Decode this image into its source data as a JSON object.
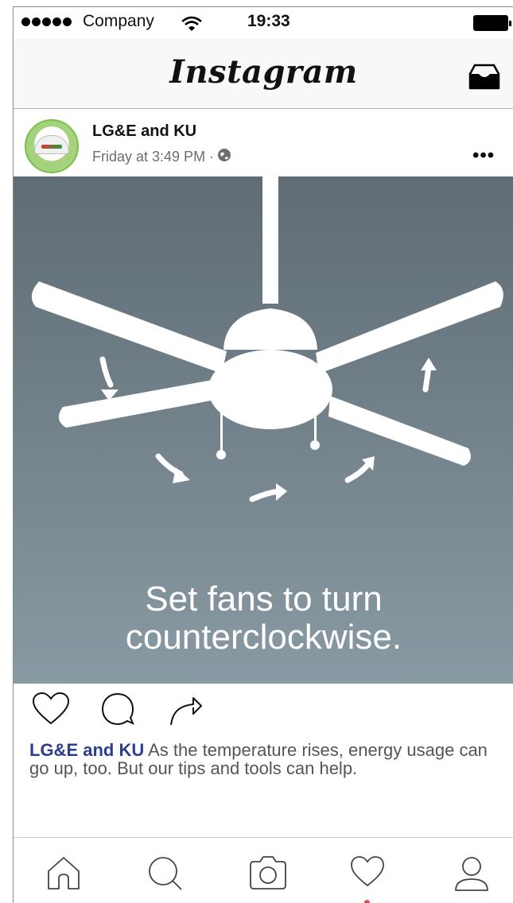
{
  "status_bar": {
    "carrier": "Company",
    "time": "19:33"
  },
  "header": {
    "title": "Instagram"
  },
  "post": {
    "author": "LG&E and KU",
    "timestamp": "Friday at 3:49 PM ·",
    "image_text": "Set fans to turn counterclockwise.",
    "caption_author": "LG&E and KU",
    "caption_text": " As the temperature rises, energy usage can go up, too. But our tips and tools can help."
  },
  "icons": {
    "signal": "signal-dots-icon",
    "wifi": "wifi-icon",
    "battery": "battery-icon",
    "inbox": "inbox-icon",
    "globe": "globe-icon",
    "more": "more-dots-icon",
    "like": "heart-icon",
    "comment": "comment-icon",
    "share": "share-icon",
    "home": "home-icon",
    "search": "search-icon",
    "camera": "camera-icon",
    "activity": "heart-icon",
    "profile": "profile-icon"
  },
  "colors": {
    "username": "#2b3f8f",
    "notification_dot": "#e8485a"
  }
}
